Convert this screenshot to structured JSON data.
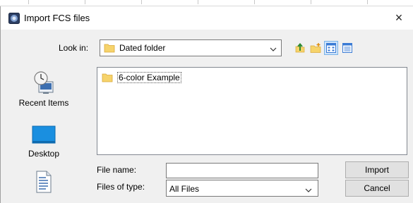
{
  "window": {
    "title": "Import FCS files",
    "app_icon": "app-logo-icon",
    "close_glyph": "×"
  },
  "look_in": {
    "label": "Look in:",
    "value": "Dated folder",
    "folder_icon": "folder-icon",
    "dropdown_icon": "chevron-down-icon"
  },
  "toolbar": {
    "buttons": [
      {
        "icon": "up-one-level-icon"
      },
      {
        "icon": "create-new-folder-icon"
      },
      {
        "icon": "list-view-icon"
      },
      {
        "icon": "details-view-icon"
      }
    ]
  },
  "sidebar": {
    "items": [
      {
        "label": "Recent Items",
        "icon": "recent-items-icon"
      },
      {
        "label": "Desktop",
        "icon": "desktop-icon"
      },
      {
        "label": "",
        "icon": "documents-icon"
      }
    ]
  },
  "file_list": {
    "items": [
      {
        "name": "6-color Example",
        "icon": "folder-icon"
      }
    ]
  },
  "file_name": {
    "label": "File name:",
    "value": "",
    "placeholder": ""
  },
  "file_type": {
    "label": "Files of type:",
    "value": "All Files",
    "dropdown_icon": "chevron-down-icon"
  },
  "actions": {
    "import_label": "Import",
    "cancel_label": "Cancel"
  },
  "colors": {
    "folder": "#f6d36b",
    "desktop": "#1a8fe0",
    "window_bg": "#f0f0f0",
    "list_bg": "#ffffff"
  }
}
